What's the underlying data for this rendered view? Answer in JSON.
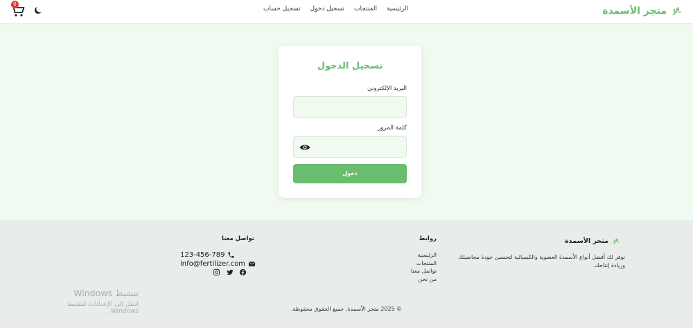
{
  "header": {
    "logo_text": "متجر الأسمدة",
    "nav": [
      "الرئيسية",
      "المنتجات",
      "تسجيل دخول",
      "تسجيل حساب"
    ],
    "cart_count": "0"
  },
  "login": {
    "title": "تسجيل الدخول",
    "email_label": "البريد الإلكتروني",
    "email_value": "",
    "password_label": "كلمة المرور",
    "password_value": "",
    "submit_label": "دخول"
  },
  "footer": {
    "brand": "متجر الأسمدة",
    "description": "نوفر لك أفضل أنواع الأسمدة العضوية والكيميائية لتحسين جودة محاصيلك وزيادة إنتاجك.",
    "links_title": "روابط",
    "links": [
      "الرئيسية",
      "المنتجات",
      "تواصل معنا",
      "من نحن"
    ],
    "contact_title": "تواصل معنا",
    "phone": "123-456-789",
    "email": "info@fertilizer.com",
    "copyright": "© 2025 متجر الأسمدة. جميع الحقوق محفوظة."
  },
  "watermark": {
    "line1": "تنشيط Windows",
    "line2": "انتقل إلى الإعدادات لتنشيط Windows."
  },
  "colors": {
    "accent": "#6abd6e",
    "page_bg": "#f1faf1",
    "footer_bg": "#e9ede9",
    "badge": "#e53935"
  },
  "icons": [
    "leaf-icon",
    "cart-icon",
    "moon-icon",
    "eye-icon",
    "phone-icon",
    "envelope-icon",
    "facebook-icon",
    "twitter-icon",
    "instagram-icon"
  ]
}
